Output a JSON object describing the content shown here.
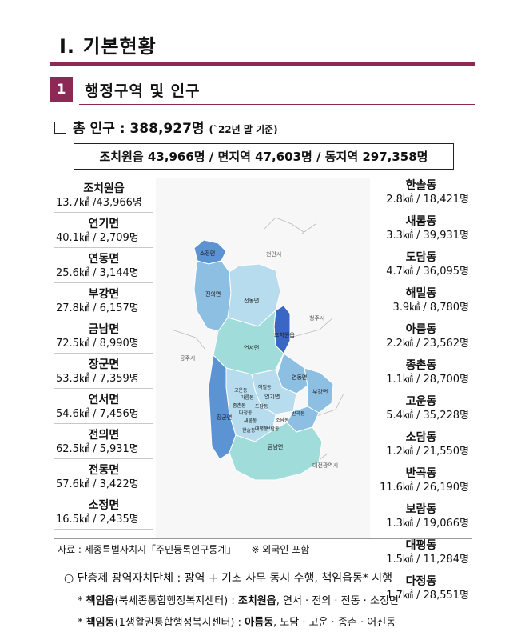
{
  "chapter": {
    "title": "Ⅰ. 기본현황"
  },
  "section": {
    "number": "1",
    "title": "행정구역 및 인구"
  },
  "total": {
    "label": "총 인구 : 388,927명",
    "basis": "(`22년 말 기준)"
  },
  "summary": "조치원읍 43,966명 / 면지역 47,603명 / 동지역 297,358명",
  "left_list": [
    {
      "name": "조치원읍",
      "stat": "13.7㎢ /43,966명"
    },
    {
      "name": "연기면",
      "stat": "40.1㎢ / 2,709명"
    },
    {
      "name": "연동면",
      "stat": "25.6㎢ / 3,144명"
    },
    {
      "name": "부강면",
      "stat": "27.8㎢ / 6,157명"
    },
    {
      "name": "금남면",
      "stat": "72.5㎢ / 8,990명"
    },
    {
      "name": "장군면",
      "stat": "53.3㎢ / 7,359명"
    },
    {
      "name": "연서면",
      "stat": "54.6㎢ / 7,456명"
    },
    {
      "name": "전의면",
      "stat": "62.5㎢ / 5,931명"
    },
    {
      "name": "전동면",
      "stat": "57.6㎢ / 3,422명"
    },
    {
      "name": "소정면",
      "stat": "16.5㎢ / 2,435명"
    }
  ],
  "right_list": [
    {
      "name": "한솔동",
      "stat": "2.8㎢ / 18,421명"
    },
    {
      "name": "새롬동",
      "stat": "3.3㎢ /  39,931명"
    },
    {
      "name": "도담동",
      "stat": "4.7㎢ / 36,095명"
    },
    {
      "name": "해밀동",
      "stat": "3.9㎢ / 8,780명"
    },
    {
      "name": "아름동",
      "stat": "2.2㎢ / 23,562명"
    },
    {
      "name": "종촌동",
      "stat": "1.1㎢ / 28,700명"
    },
    {
      "name": "고운동",
      "stat": "5.4㎢ / 35,228명"
    },
    {
      "name": "소담동",
      "stat": "1.2㎢ / 21,550명"
    },
    {
      "name": "반곡동",
      "stat": "11.6㎢ / 26,190명"
    },
    {
      "name": "보람동",
      "stat": "1.3㎢ /  19,066명"
    },
    {
      "name": "대평동",
      "stat": "1.5㎢ /  11,284명"
    },
    {
      "name": "다정동",
      "stat": "1.7㎢ / 28,551명"
    }
  ],
  "map": {
    "outside": [
      "천안시",
      "청주시",
      "공주시",
      "대전광역시"
    ],
    "regions": [
      "소정면",
      "전의면",
      "전동면",
      "조치원읍",
      "연서면",
      "연동면",
      "부강면",
      "연기면",
      "장군면",
      "금남면"
    ],
    "dongs": [
      "고운동",
      "아름동",
      "해밀동",
      "종촌동",
      "다정동",
      "도담동",
      "새롬동",
      "한솔동",
      "대평동",
      "보람동",
      "소담동",
      "반곡동"
    ],
    "colors": {
      "dark": "#5b93d3",
      "mid": "#8dbfe3",
      "light": "#b7dcee",
      "teal": "#9fdcda",
      "navy": "#3a67c4"
    }
  },
  "source": {
    "text": "자료 : 세종특별자치시「주민등록인구통계」",
    "note": "※ 외국인 포함"
  },
  "notes": {
    "line1": "○  단층제  광역자치단체 : 광역 + 기초 사무 동시 수행, 책임읍동* 시행",
    "line2": {
      "star": "*",
      "label": "책임읍",
      "paren": "(북세종통합행정복지센터) : ",
      "bold": "조치원읍",
      "rest": ",  연서 · 전의 · 전동 · 소정면"
    },
    "line3": {
      "star": "*",
      "label": "책임동",
      "paren": "(1생활권통합행정복지센터) : ",
      "bold": "아름동",
      "rest": ",  도담 · 고운 · 종촌 · 어진동"
    }
  }
}
